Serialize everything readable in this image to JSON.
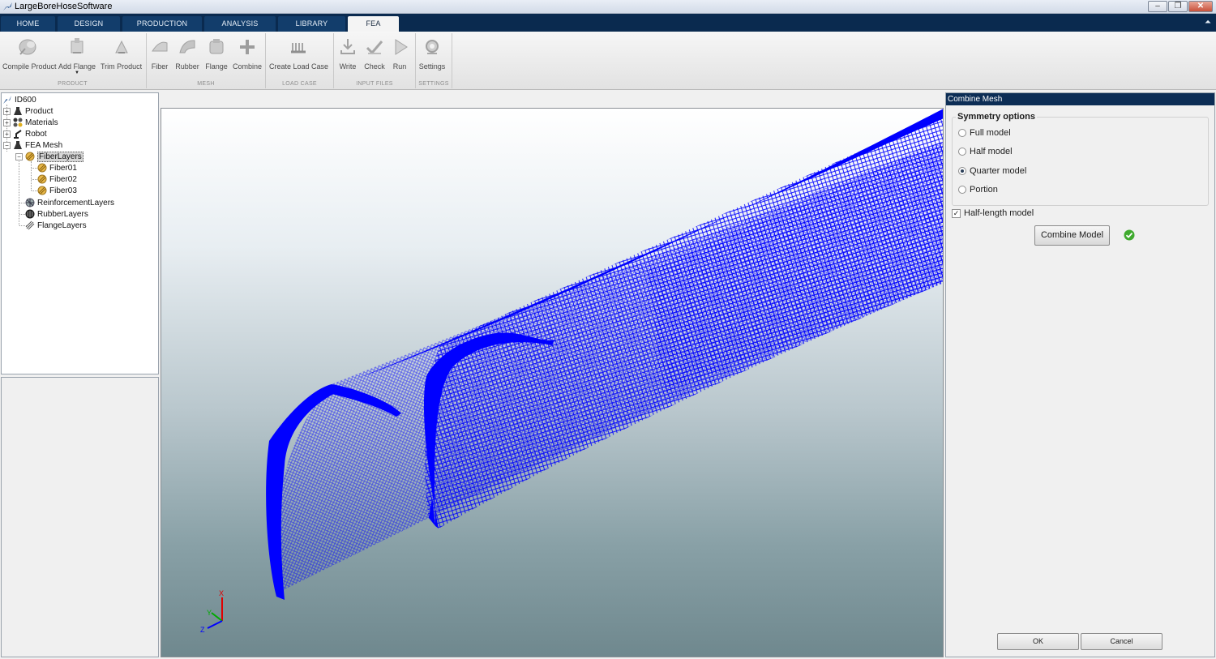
{
  "window": {
    "title": "LargeBoreHoseSoftware"
  },
  "tabs": [
    "HOME",
    "DESIGN",
    "PRODUCTION",
    "ANALYSIS",
    "LIBRARY",
    "FEA"
  ],
  "active_tab": "FEA",
  "ribbon": {
    "product": {
      "label": "PRODUCT",
      "buttons": [
        "Compile Product",
        "Add Flange",
        "Trim Product"
      ]
    },
    "mesh": {
      "label": "MESH",
      "buttons": [
        "Fiber",
        "Rubber",
        "Flange",
        "Combine"
      ]
    },
    "load_case": {
      "label": "LOAD CASE",
      "buttons": [
        "Create Load Case"
      ]
    },
    "input_files": {
      "label": "INPUT FILES",
      "buttons": [
        "Write",
        "Check",
        "Run"
      ]
    },
    "settings": {
      "label": "SETTINGS",
      "buttons": [
        "Settings"
      ]
    }
  },
  "tree": {
    "root": "ID600",
    "product": "Product",
    "materials": "Materials",
    "robot": "Robot",
    "fea_mesh": "FEA Mesh",
    "fiber_layers": "FiberLayers",
    "fiber01": "Fiber01",
    "fiber02": "Fiber02",
    "fiber03": "Fiber03",
    "reinforcement": "ReinforcementLayers",
    "rubber": "RubberLayers",
    "flange": "FlangeLayers"
  },
  "viewport": {
    "mesh_color": "#0000ff",
    "axis_labels": {
      "x": "X",
      "y": "Y",
      "z": "Z"
    }
  },
  "panel": {
    "title": "Combine Mesh",
    "symmetry_title": "Symmetry options",
    "options": [
      "Full model",
      "Half model",
      "Quarter model",
      "Portion"
    ],
    "selected_option": "Quarter model",
    "half_length_label": "Half-length model",
    "half_length_checked": true,
    "combine_button": "Combine Model",
    "combine_status": "done",
    "ok_button": "OK",
    "cancel_button": "Cancel"
  }
}
